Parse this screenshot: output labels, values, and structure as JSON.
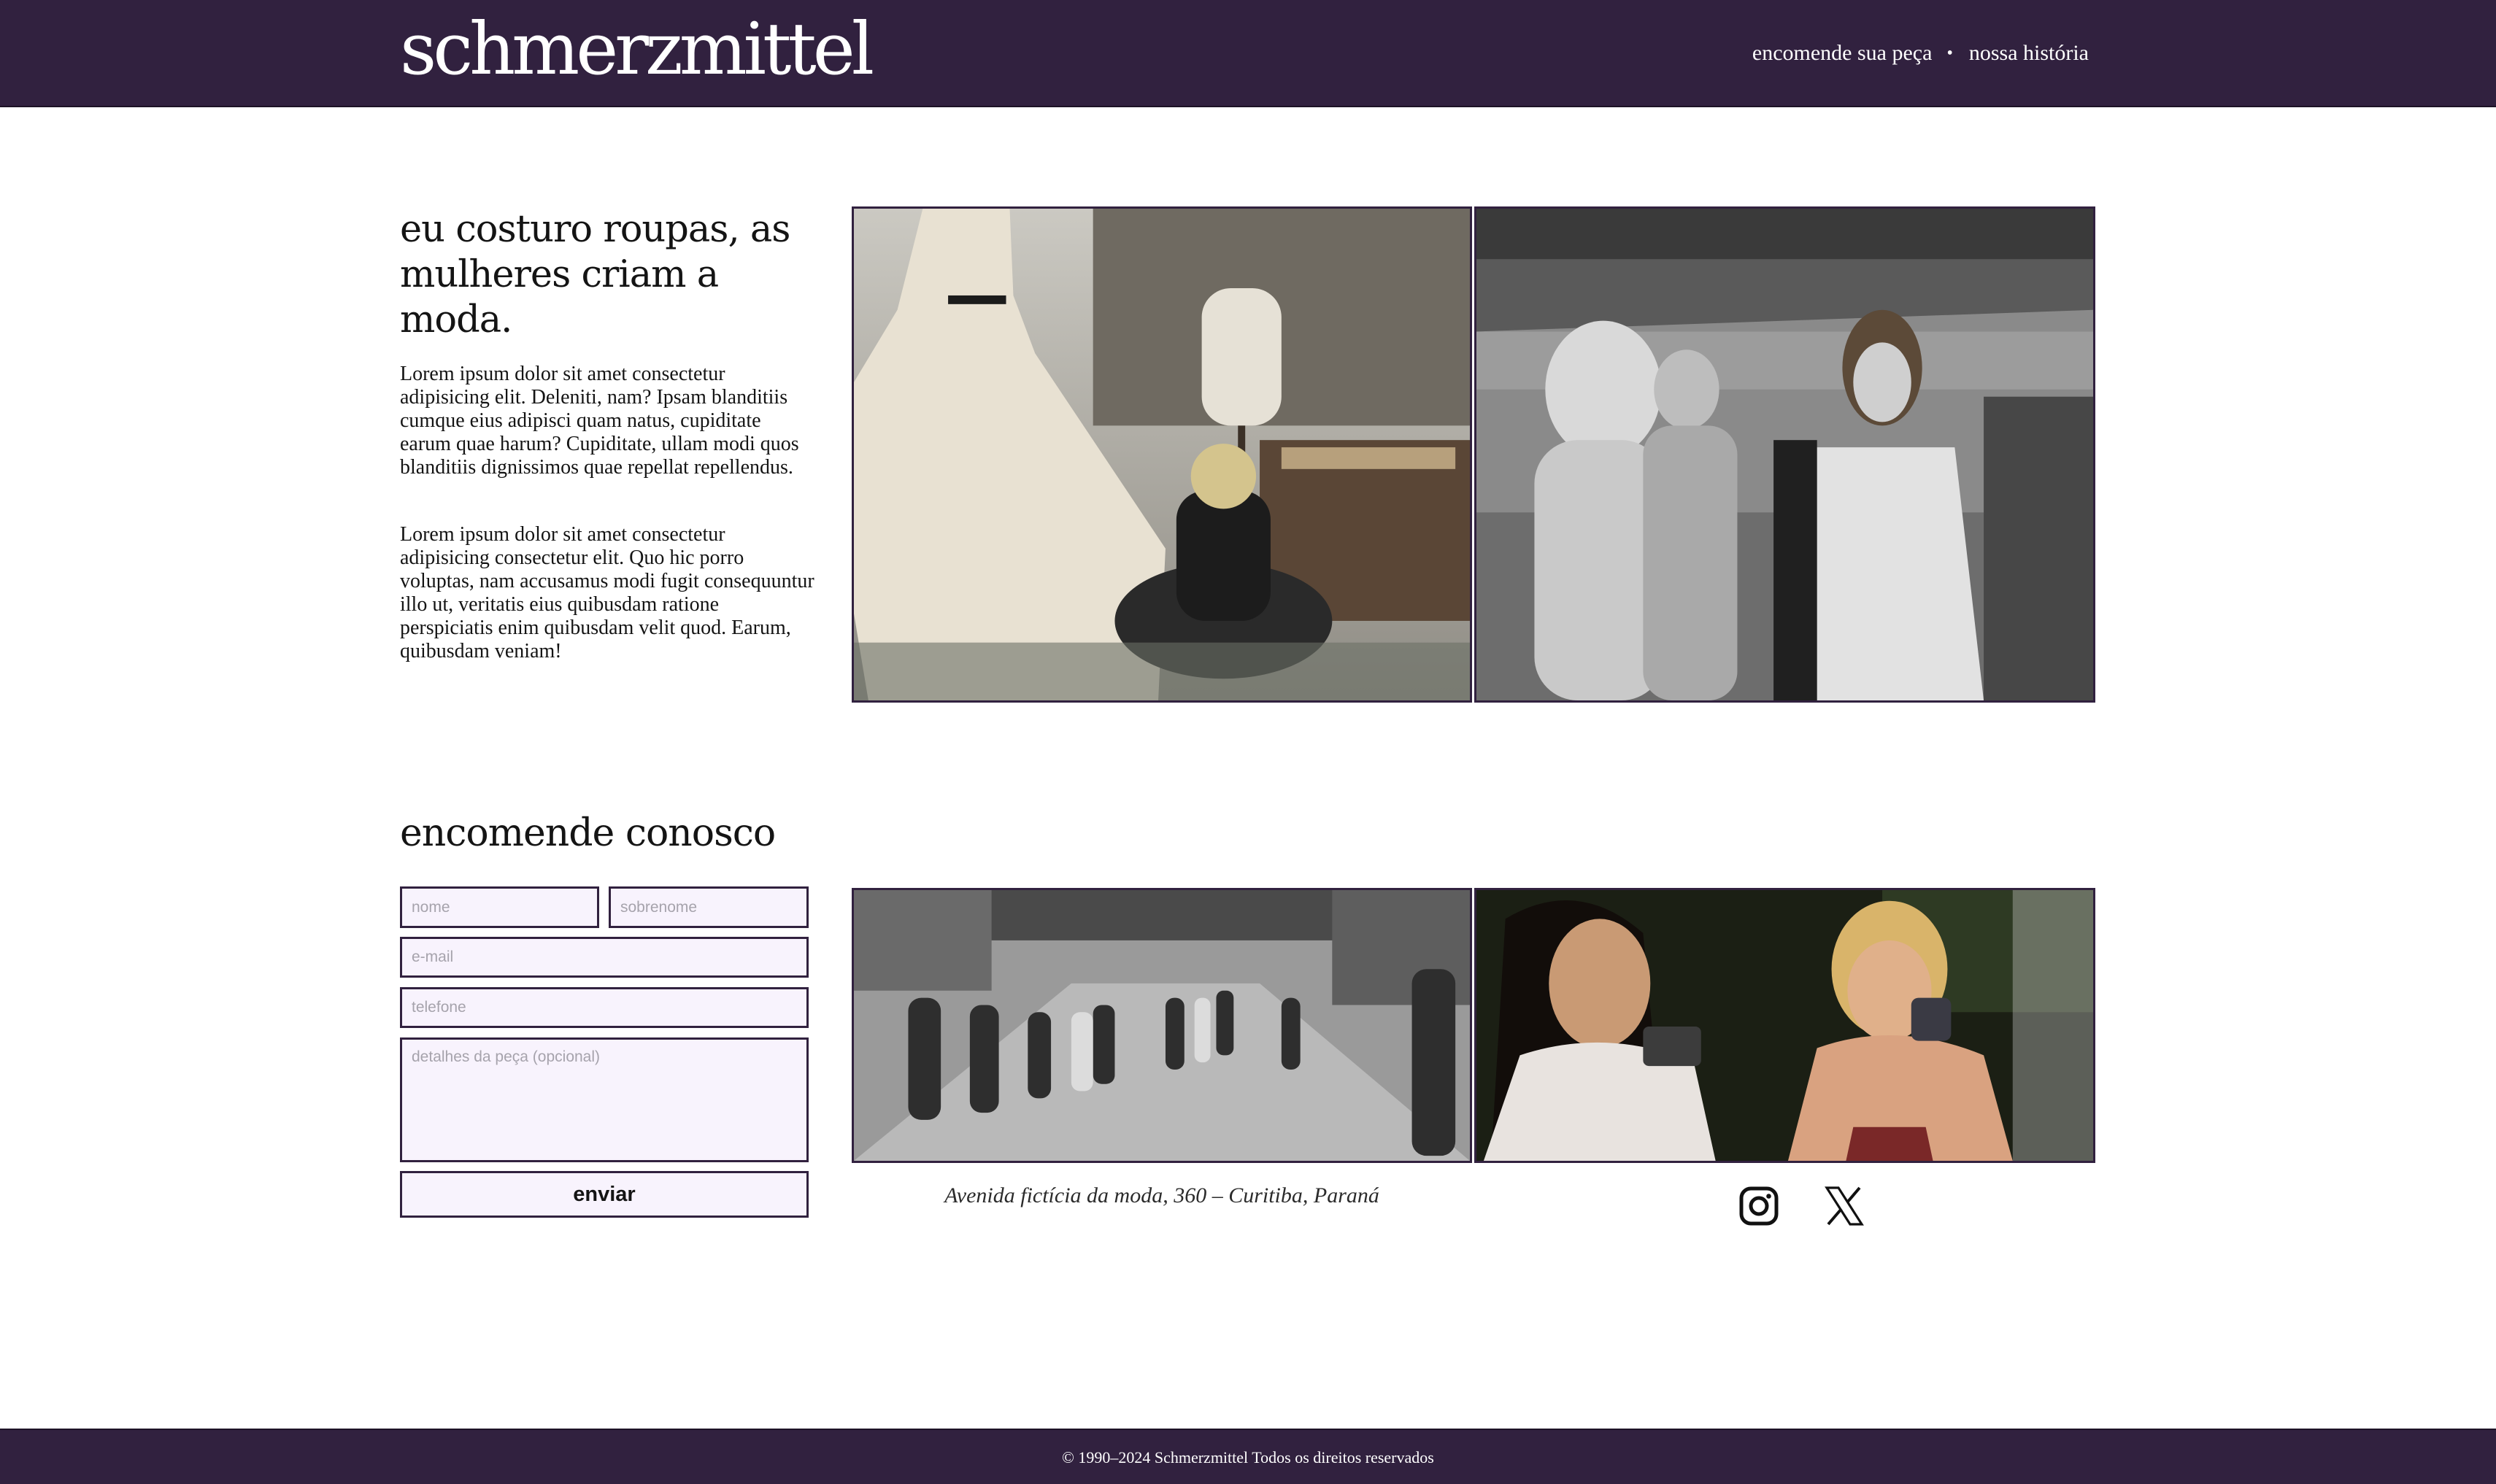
{
  "header": {
    "logo": "schmerzmittel",
    "nav": [
      {
        "label": "encomende sua peça"
      },
      {
        "label": "nossa história"
      }
    ],
    "separator": "•"
  },
  "hero": {
    "title": "eu costuro roupas, as mulheres criam a moda.",
    "paragraphs": [
      "Lorem ipsum dolor sit amet consectetur adipisicing elit. Deleniti, nam? Ipsam blanditiis cumque eius adipisci quam natus, cupiditate earum quae harum? Cupiditate, ullam modi quos blanditiis dignissimos quae repellat repellendus.",
      "Lorem ipsum dolor sit amet consectetur adipisicing consectetur elit. Quo hic porro voluptas, nam accusamus modi fugit consequuntur illo ut, veritatis eius quibusdam ratione perspiciatis enim quibusdam velit quod. Earum, quibusdam veniam!"
    ]
  },
  "order": {
    "title": "encomende conosco",
    "fields": {
      "nome": {
        "placeholder": "nome",
        "value": ""
      },
      "sobrenome": {
        "placeholder": "sobrenome",
        "value": ""
      },
      "email": {
        "placeholder": "e-mail",
        "value": ""
      },
      "telefone": {
        "placeholder": "telefone",
        "value": ""
      },
      "detalhes": {
        "placeholder": "detalhes da peça (opcional)",
        "value": ""
      }
    },
    "submit_label": "enviar"
  },
  "address": "Avenida fictícia da moda, 360 – Curitiba, Paraná",
  "social": [
    {
      "icon": "instagram-icon"
    },
    {
      "icon": "x-icon"
    }
  ],
  "footer": {
    "text": "© 1990–2024 Schmerzmittel Todos os direitos reservados"
  },
  "colors": {
    "brand": "#31213f",
    "field_bg": "#f8f3fd",
    "page_bg": "#ffffff"
  }
}
